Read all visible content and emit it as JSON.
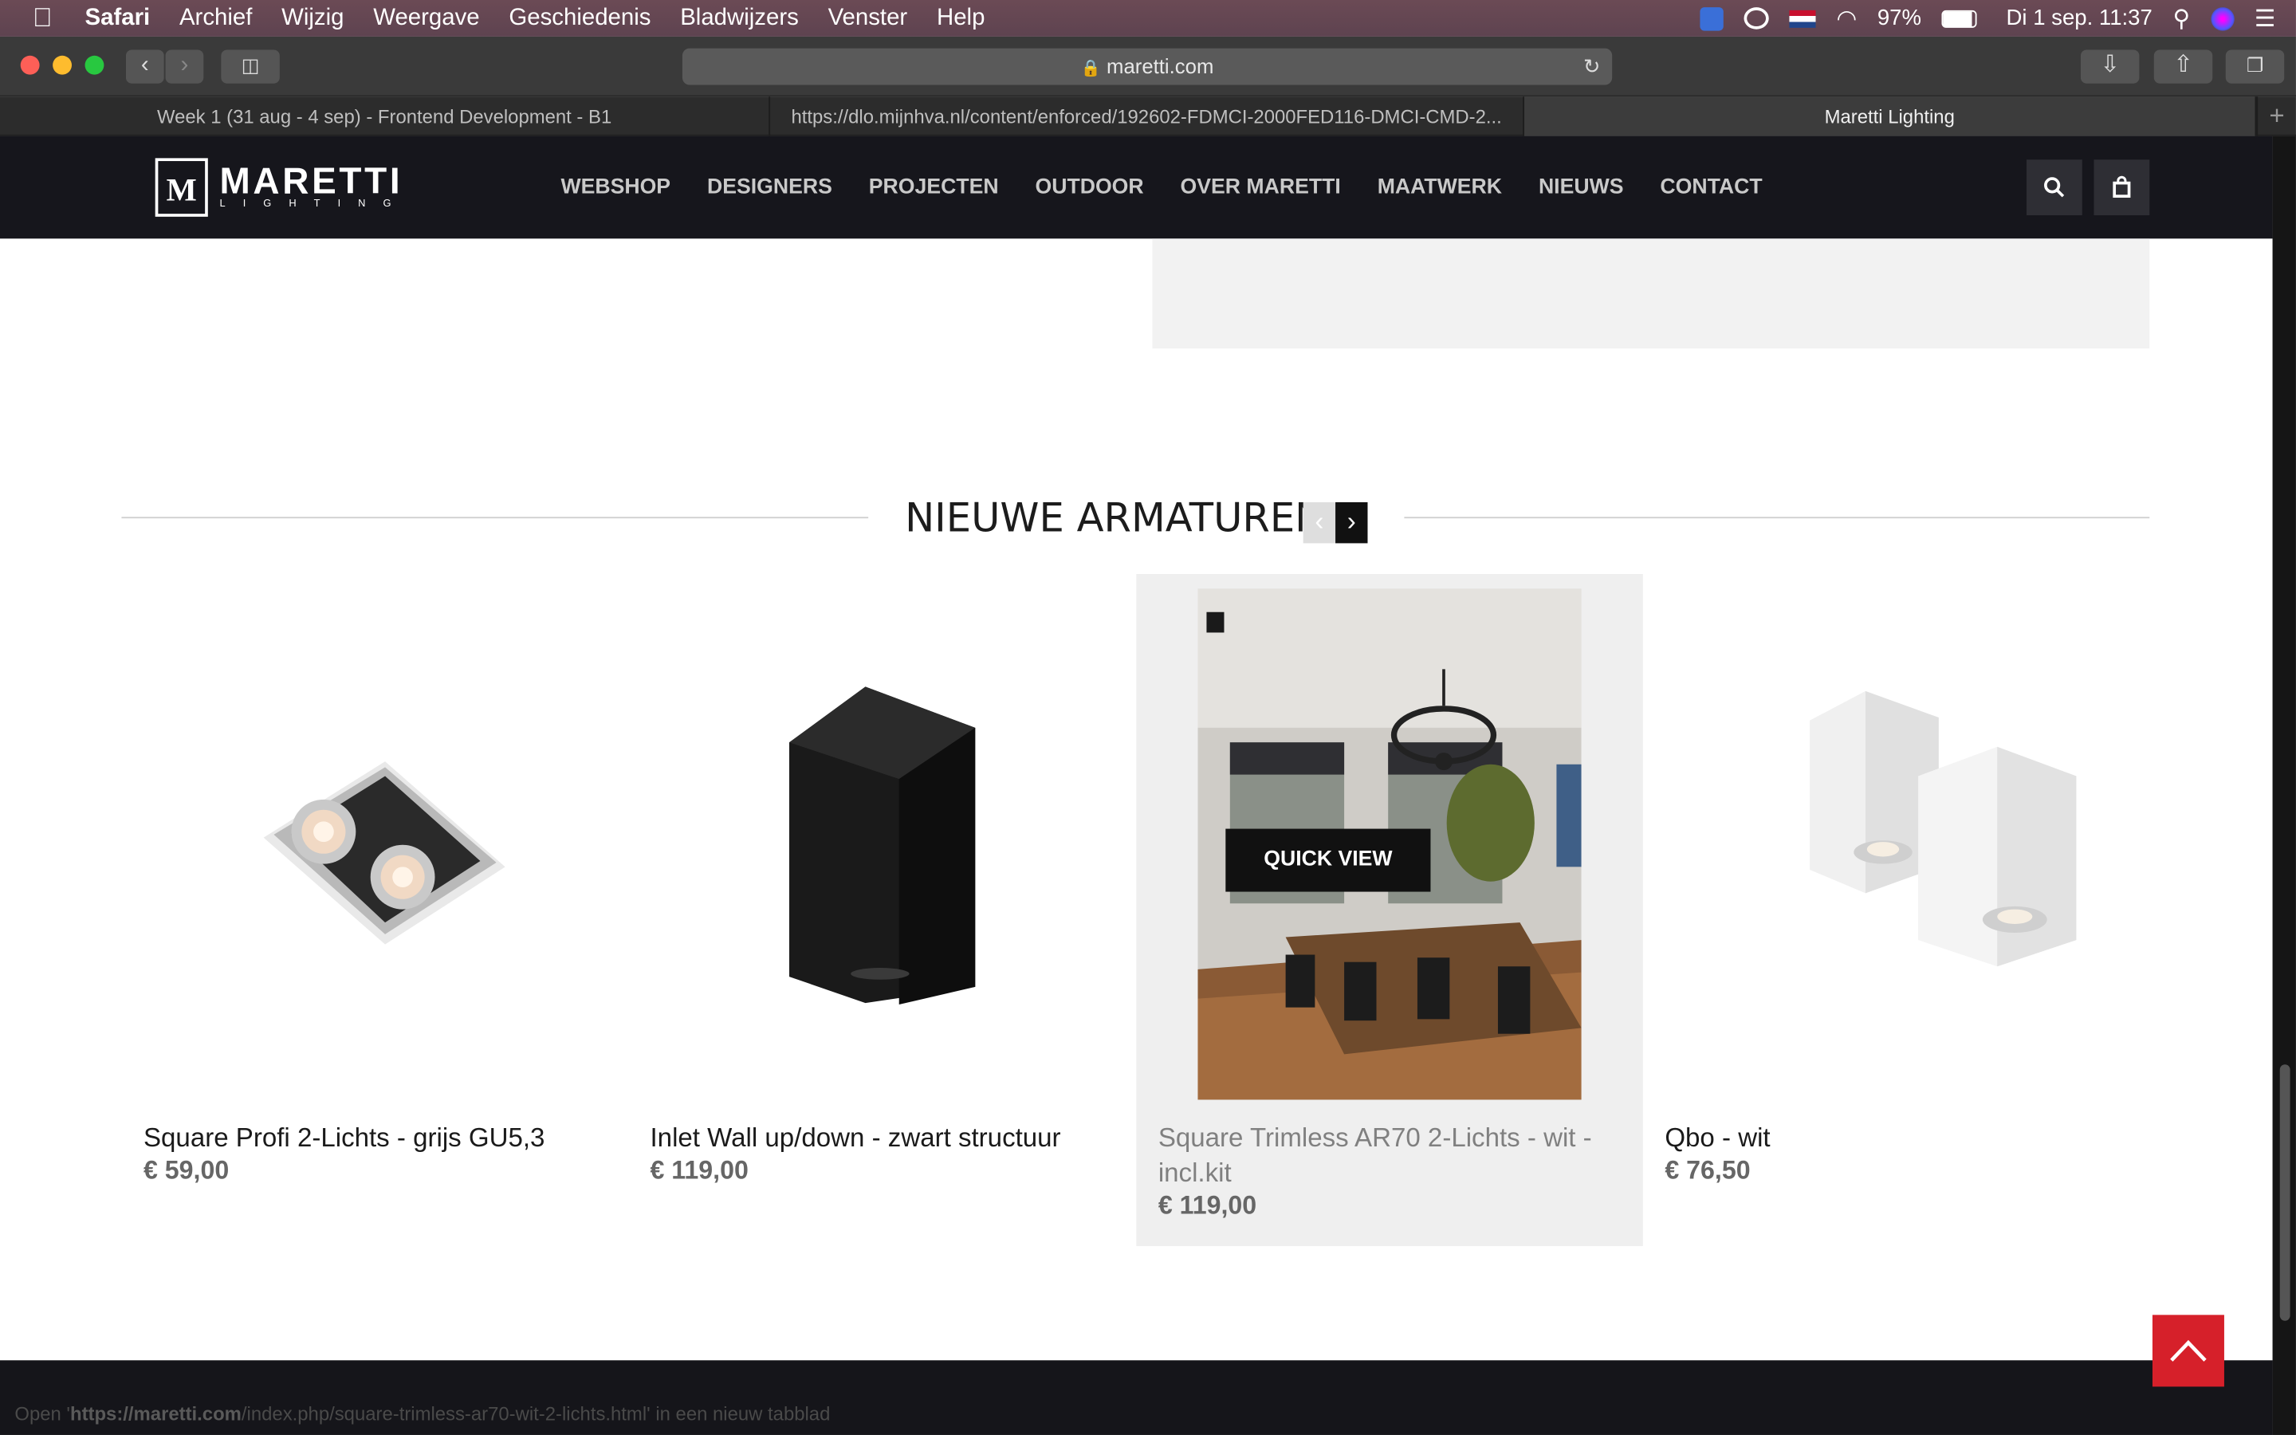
{
  "menubar": {
    "app": "Safari",
    "items": [
      "Archief",
      "Wijzig",
      "Weergave",
      "Geschiedenis",
      "Bladwijzers",
      "Venster",
      "Help"
    ],
    "battery": "97%",
    "datetime": "Di 1 sep.  11:37"
  },
  "browser": {
    "url": "maretti.com",
    "tabs": [
      {
        "title": "Week 1 (31 aug - 4 sep) - Frontend Development - B1",
        "active": false
      },
      {
        "title": "https://dlo.mijnhva.nl/content/enforced/192602-FDMCI-2000FED116-DMCI-CMD-2...",
        "active": false
      },
      {
        "title": "Maretti Lighting",
        "active": true
      }
    ]
  },
  "site": {
    "logo_text": "MARETTI",
    "logo_sub": "LIGHTING",
    "emblem_letter": "M",
    "nav": [
      "WEBSHOP",
      "DESIGNERS",
      "PROJECTEN",
      "OUTDOOR",
      "OVER MARETTI",
      "MAATWERK",
      "NIEUWS",
      "CONTACT"
    ]
  },
  "section": {
    "title": "NIEUWE ARMATUREN"
  },
  "products": [
    {
      "name": "Square Profi 2-Lichts - grijs GU5,3",
      "price": "€ 59,00",
      "image": "recessed-double-spot-grey"
    },
    {
      "name": "Inlet Wall up/down - zwart structuur",
      "price": "€ 119,00",
      "image": "wall-light-black-box"
    },
    {
      "name": "Square Trimless AR70 2-Lichts - wit - incl.kit",
      "price": "€ 119,00",
      "image": "meeting-room-photo",
      "hover_label": "QUICK VIEW"
    },
    {
      "name": "Qbo - wit",
      "price": "€ 76,50",
      "image": "white-cube-ceiling-lights"
    }
  ],
  "status_bar": {
    "prefix": "Open '",
    "host": "https://maretti.com",
    "path": "/index.php/square-trimless-ar70-wit-2-lichts.html",
    "suffix": "' in een nieuw tabblad"
  },
  "colors": {
    "header_bg": "#16161c",
    "accent_red": "#d6202a",
    "price_grey": "#666666"
  }
}
